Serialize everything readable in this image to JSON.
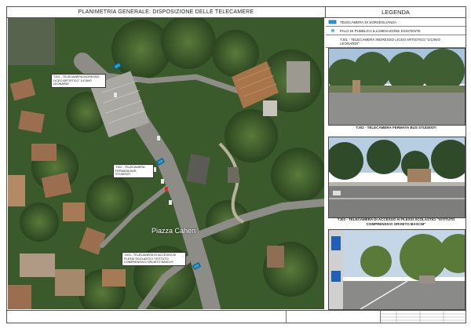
{
  "sheet": {
    "main_title": "PLANIMETRIA GENERALE: DISPOSIZIONE DELLE TELECAMERE",
    "legend_title": "LEGENDA"
  },
  "legend": {
    "items": [
      {
        "label": "TELECAMERA DI SORVEGLIANZA",
        "icon": "camera-icon"
      },
      {
        "label": "PALO DI PUBBLICA ILLUMINAZIONE ESISTENTE",
        "icon": "lamp-post-icon"
      },
      {
        "label": "TJ01 - TELECAMERA INGRESSO LICEO ARTISTICO \"LICINIO LEONARDI\"",
        "icon": ""
      }
    ]
  },
  "photos": [
    {
      "caption": "TJ02 - TELECAMERA FERMATA BUS STUDENTI"
    },
    {
      "caption": "TJ03 - TELECAMERA DI ACCESSO AI PLESSI SCOLASTICI \"ISTITUTO COMPRENSIVO ORVIETO BASCHI\""
    },
    {
      "caption": ""
    }
  ],
  "map": {
    "place_label": "Piazza Cahen",
    "callouts": [
      {
        "text": "TJ01 - TELECAMERA INGRESSO LICEO ARTISTICO \"LICINIO LEONARDI\""
      },
      {
        "text": "TJ02 - TELECAMERA FERMATA BUS STUDENTI"
      },
      {
        "text": "TJ03 - TELECAMERA DI ACCESSO AI PLESSI SCOLASTICI \"ISTITUTO COMPRENSIVO ORVIETO BASCHI\""
      }
    ]
  },
  "colors": {
    "camera": "#1ea0d8",
    "vegetation": "#3c5a2e",
    "road": "#8d8c86"
  }
}
